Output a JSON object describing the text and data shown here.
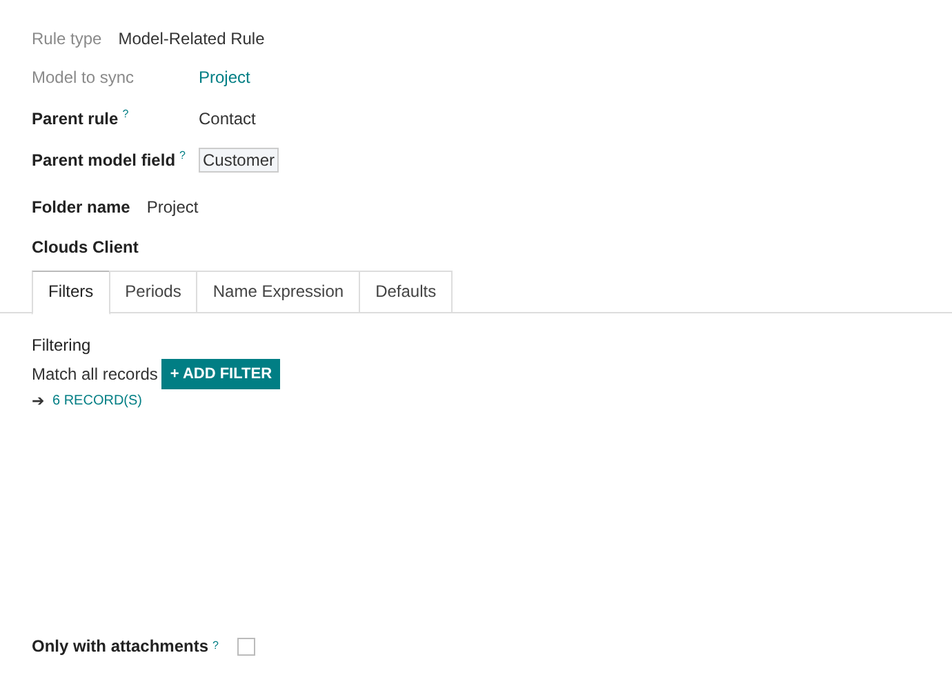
{
  "rule_type": {
    "label": "Rule type",
    "value": "Model-Related Rule"
  },
  "fields": [
    {
      "label": "Model to sync",
      "muted": true,
      "kind": "link",
      "value": "Project"
    },
    {
      "label": "Parent rule",
      "muted": false,
      "help": "?",
      "kind": "text",
      "value": "Contact"
    },
    {
      "label": "Parent model field",
      "muted": false,
      "help": "?",
      "kind": "boxed",
      "value": "Customer"
    }
  ],
  "folder": {
    "label": "Folder name",
    "value": "Project"
  },
  "section_title": "Clouds Client",
  "tabs": [
    {
      "label": "Filters",
      "selected": true
    },
    {
      "label": "Periods",
      "selected": false
    },
    {
      "label": "Name Expression",
      "selected": false
    },
    {
      "label": "Defaults",
      "selected": false
    }
  ],
  "filtering": {
    "title": "Filtering",
    "match": "Match all records",
    "add_button": "+ ADD FILTER",
    "records_arrow": "➔",
    "records": "6 RECORD(S)"
  },
  "attachments": {
    "label": "Only with attachments",
    "help": "?",
    "checked": false
  }
}
